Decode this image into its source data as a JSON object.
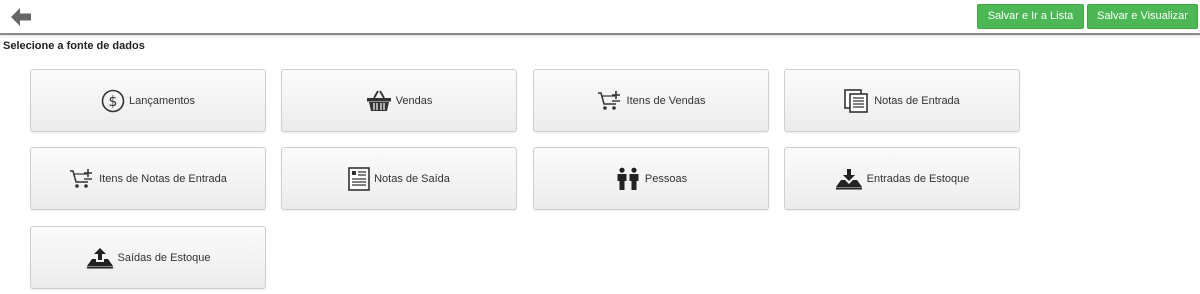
{
  "header": {
    "back_icon": "arrow-left-icon",
    "save_list_label": "Salvar e Ir a Lista",
    "save_view_label": "Salvar e Visualizar",
    "accent_color": "#4cb855"
  },
  "main": {
    "title": "Selecione a fonte de dados",
    "sources": [
      {
        "label": "Lançamentos",
        "icon": "dollar-circle-icon"
      },
      {
        "label": "Vendas",
        "icon": "basket-icon"
      },
      {
        "label": "Itens de Vendas",
        "icon": "cart-add-icon"
      },
      {
        "label": "Notas de Entrada",
        "icon": "documents-icon"
      },
      {
        "label": "Itens de Notas de Entrada",
        "icon": "cart-add-icon"
      },
      {
        "label": "Notas de Saída",
        "icon": "receipt-icon"
      },
      {
        "label": "Pessoas",
        "icon": "people-icon"
      },
      {
        "label": "Entradas de Estoque",
        "icon": "tray-download-icon"
      },
      {
        "label": "Saídas de Estoque",
        "icon": "tray-upload-icon"
      }
    ]
  }
}
